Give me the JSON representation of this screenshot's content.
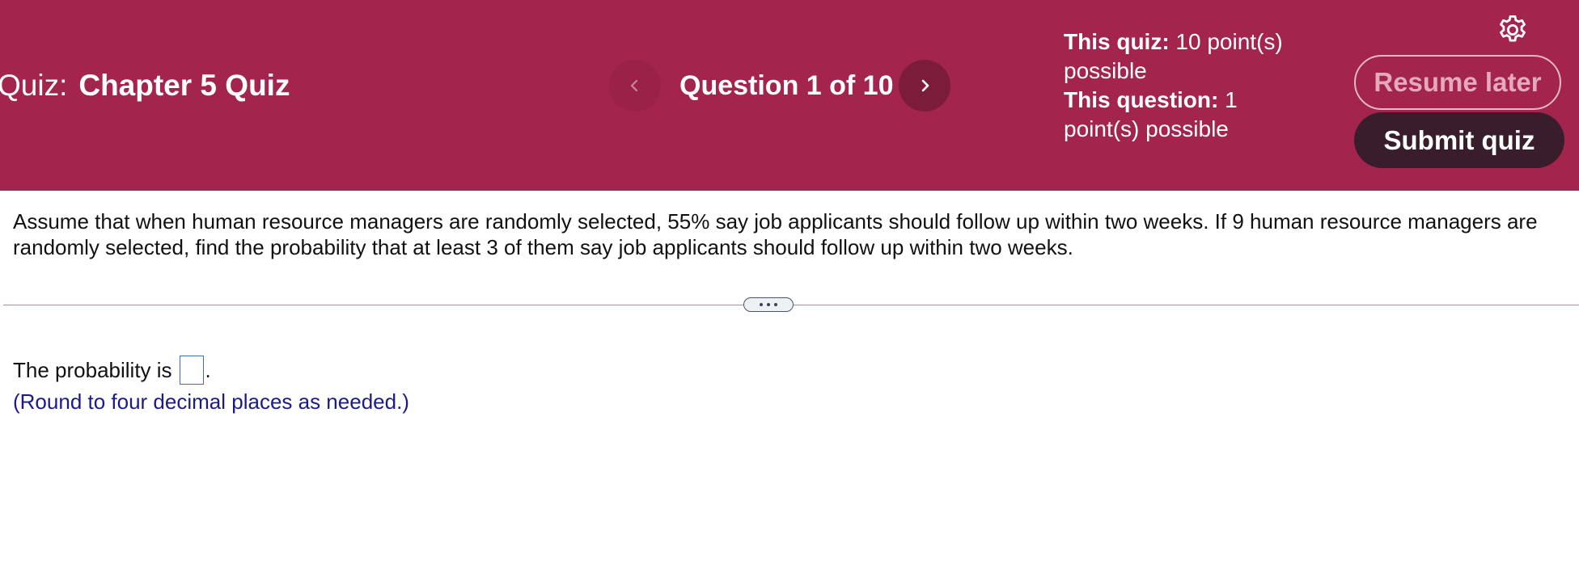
{
  "header": {
    "quiz_prefix": "Quiz:",
    "quiz_name": "Chapter 5 Quiz",
    "question_counter": "Question 1 of 10",
    "points": {
      "quiz_label": "This quiz:",
      "quiz_value": " 10 point(s) possible",
      "question_label": "This question:",
      "question_value": " 1 point(s) possible"
    },
    "resume_label": "Resume later",
    "submit_label": "Submit quiz",
    "icons": {
      "prev": "chevron-left-icon",
      "next": "chevron-right-icon",
      "settings": "gear-icon"
    },
    "colors": {
      "header_bg": "#a3244d",
      "submit_bg": "#3a1d2c"
    }
  },
  "question": {
    "text": "Assume that when human resource managers are randomly selected, 55% say job applicants should follow up within two weeks. If 9 human resource managers are randomly selected, find the probability that at least 3 of them say job applicants should follow up within two weeks."
  },
  "answer": {
    "prefix": "The probability is",
    "suffix": ".",
    "value": "",
    "hint": "(Round to four decimal places as needed.)"
  }
}
